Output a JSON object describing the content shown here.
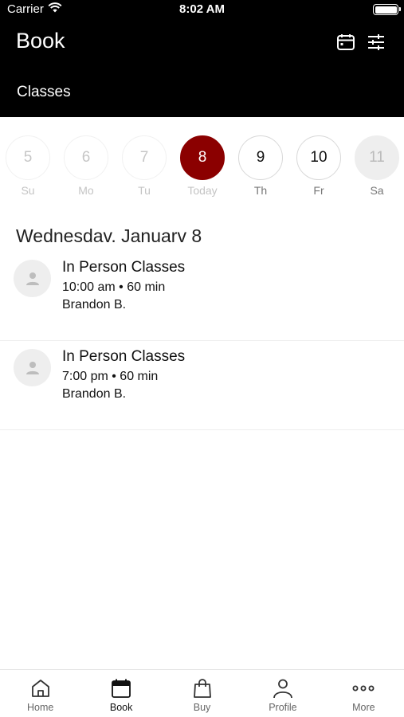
{
  "status": {
    "carrier": "Carrier",
    "time": "8:02 AM"
  },
  "header": {
    "title": "Book",
    "subtitle": "Classes",
    "icons": [
      "calendar-icon",
      "sliders-icon"
    ]
  },
  "days": [
    {
      "num": "5",
      "label": "Su",
      "state": "faded"
    },
    {
      "num": "6",
      "label": "Mo",
      "state": "faded"
    },
    {
      "num": "7",
      "label": "Tu",
      "state": "faded"
    },
    {
      "num": "8",
      "label": "Today",
      "state": "today"
    },
    {
      "num": "9",
      "label": "Th",
      "state": "active"
    },
    {
      "num": "10",
      "label": "Fr",
      "state": "active"
    },
    {
      "num": "11",
      "label": "Sa",
      "state": "muted"
    }
  ],
  "date_heading": "Wednesdav. Januarv 8",
  "classes": [
    {
      "name": "In Person Classes",
      "time": "10:00 am • 60 min",
      "instructor": "Brandon B."
    },
    {
      "name": "In Person Classes",
      "time": "7:00 pm • 60 min",
      "instructor": "Brandon B."
    }
  ],
  "tabs": [
    {
      "label": "Home",
      "icon": "home-icon",
      "active": false
    },
    {
      "label": "Book",
      "icon": "calendar-filled-icon",
      "active": true
    },
    {
      "label": "Buy",
      "icon": "shopping-bag-icon",
      "active": false
    },
    {
      "label": "Profile",
      "icon": "person-icon",
      "active": false
    },
    {
      "label": "More",
      "icon": "more-dots-icon",
      "active": false
    }
  ],
  "colors": {
    "accent": "#8b0000",
    "header_bg": "#000000"
  }
}
